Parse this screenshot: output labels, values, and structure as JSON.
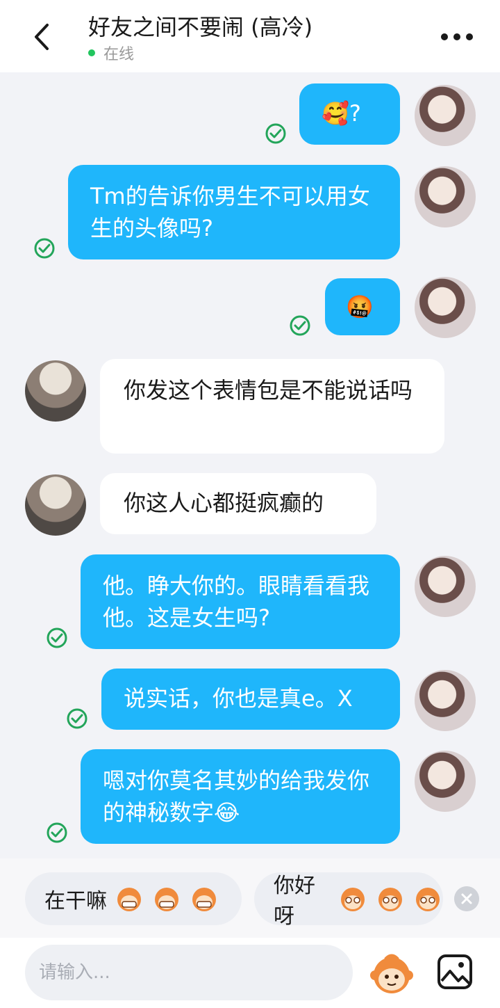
{
  "header": {
    "title": "好友之间不要闹 (高冷)",
    "status": "在线"
  },
  "messages": [
    {
      "side": "out",
      "text": "🥰?"
    },
    {
      "side": "out",
      "text": "Tm的告诉你男生不可以用女生的头像吗?"
    },
    {
      "side": "out",
      "text": "🤬"
    },
    {
      "side": "in",
      "text": "你发这个表情包是不能说话吗"
    },
    {
      "side": "in",
      "text": "你这人心都挺疯癫的"
    },
    {
      "side": "out",
      "text": "他。睁大你的。眼睛看看我他。这是女生吗?"
    },
    {
      "side": "out",
      "text": "说实话，你也是真e。X"
    },
    {
      "side": "out",
      "text": "嗯对你莫名其妙的给我发你的神秘数字😂"
    }
  ],
  "quick_replies": [
    "在干嘛",
    "你好呀"
  ],
  "input": {
    "placeholder": "请输入..."
  },
  "colors": {
    "bubble_out": "#1fb6fb",
    "bubble_in": "#ffffff",
    "status_dot": "#22c55e",
    "check": "#23a55a"
  }
}
